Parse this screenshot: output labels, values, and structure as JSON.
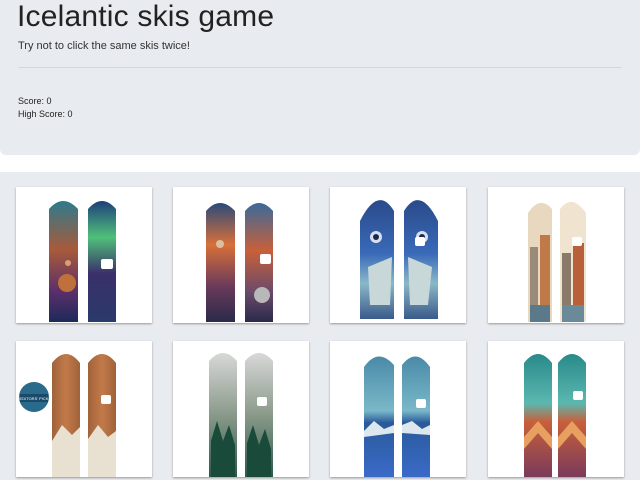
{
  "header": {
    "title": "Icelantic skis game",
    "subtitle": "Try not to click the same skis twice!",
    "score_text": "Score: 0",
    "high_score_text": "High Score: 0"
  },
  "cards": [
    {
      "name": "ski-card-galaxy",
      "design": "galaxy nebula with planet"
    },
    {
      "name": "ski-card-nebula",
      "design": "space nebula clouds with moon"
    },
    {
      "name": "ski-card-owl",
      "design": "blue owl and wolf"
    },
    {
      "name": "ski-card-city",
      "design": "cream cityscape"
    },
    {
      "name": "ski-card-wood",
      "design": "wood grain with mountains",
      "badge_text": "EDITORS' PICK"
    },
    {
      "name": "ski-card-forest",
      "design": "grey forest birds"
    },
    {
      "name": "ski-card-ice",
      "design": "blue iceberg mosaic"
    },
    {
      "name": "ski-card-geometric",
      "design": "teal sky geometric chevrons"
    }
  ],
  "colors": {
    "header_bg": "#e8ebef",
    "card_bg": "#ffffff"
  }
}
